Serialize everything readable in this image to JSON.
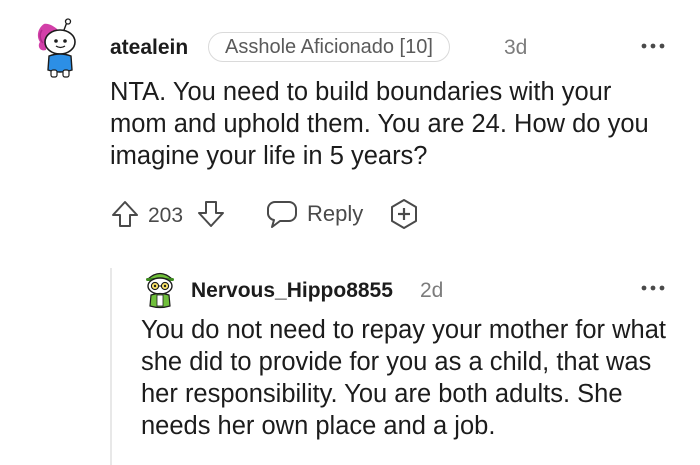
{
  "comment": {
    "avatar_icon": "snoo-avatar-icon",
    "username": "atealein",
    "flair": "Asshole Aficionado [10]",
    "age": "3d",
    "more_icon": "more-options-icon",
    "body": "NTA. You need to build boundaries with your mom and uphold them. You are 24. How do you imagine your life in 5 years?",
    "score": "203",
    "upvote_icon": "upvote-arrow-icon",
    "downvote_icon": "downvote-arrow-icon",
    "reply_icon": "speech-bubble-icon",
    "reply_label": "Reply",
    "award_icon": "award-plus-icon"
  },
  "reply": {
    "avatar_icon": "snoo-avatar-icon",
    "username": "Nervous_Hippo8855",
    "age": "2d",
    "more_icon": "more-options-icon",
    "body": "You do not need to repay your mother for what she did to provide for you as a child, that was her responsibility. You are both adults. She needs her own place and a job."
  },
  "colors": {
    "text": "#1c1c1c",
    "meta": "#7c7c7c",
    "icon": "#4a4a4a",
    "flair_border": "#dadada",
    "avatar1_hair": "#d23fa8",
    "avatar1_shirt": "#2c8fe6",
    "avatar2_accent": "#6fbf3a"
  }
}
